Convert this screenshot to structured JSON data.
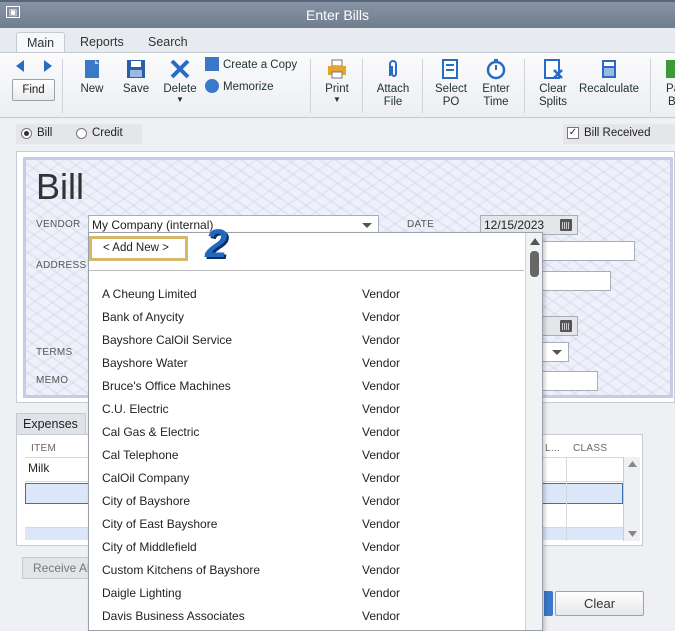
{
  "window": {
    "title": "Enter Bills"
  },
  "tabs": [
    {
      "label": "Main",
      "active": true
    },
    {
      "label": "Reports",
      "active": false
    },
    {
      "label": "Search",
      "active": false
    }
  ],
  "ribbon": {
    "find": "Find",
    "new": "New",
    "save": "Save",
    "delete": "Delete",
    "create_copy": "Create a Copy",
    "memorize": "Memorize",
    "print": "Print",
    "attach_file_1": "Attach",
    "attach_file_2": "File",
    "select_po_1": "Select",
    "select_po_2": "PO",
    "enter_time_1": "Enter",
    "enter_time_2": "Time",
    "clear_splits_1": "Clear",
    "clear_splits_2": "Splits",
    "recalculate": "Recalculate",
    "pay_bill_1": "Pa",
    "pay_bill_2": "B"
  },
  "options": {
    "bill": "Bill",
    "credit": "Credit",
    "bill_received": "Bill Received",
    "bill_selected": true,
    "bill_received_checked": true
  },
  "form": {
    "title": "Bill",
    "vendor_label": "VENDOR",
    "vendor_value": "My Company (internal)",
    "date_label": "DATE",
    "date_value": "12/15/2023",
    "address_label": "ADDRESS",
    "terms_label": "TERMS",
    "memo_label": "MEMO"
  },
  "expenses": {
    "tab_label": "Expenses",
    "col_item": "ITEM",
    "col_l": "L...",
    "col_class": "CLASS",
    "row1_item": "Milk"
  },
  "buttons": {
    "receive_all": "Receive All",
    "clear": "Clear"
  },
  "dropdown": {
    "add_new": "< Add New >",
    "items": [
      {
        "name": "A Cheung Limited",
        "type": "Vendor"
      },
      {
        "name": "Bank of Anycity",
        "type": "Vendor"
      },
      {
        "name": "Bayshore CalOil Service",
        "type": "Vendor"
      },
      {
        "name": "Bayshore Water",
        "type": "Vendor"
      },
      {
        "name": "Bruce's Office Machines",
        "type": "Vendor"
      },
      {
        "name": "C.U. Electric",
        "type": "Vendor"
      },
      {
        "name": "Cal Gas & Electric",
        "type": "Vendor"
      },
      {
        "name": "Cal Telephone",
        "type": "Vendor"
      },
      {
        "name": "CalOil Company",
        "type": "Vendor"
      },
      {
        "name": "City of Bayshore",
        "type": "Vendor"
      },
      {
        "name": "City of East Bayshore",
        "type": "Vendor"
      },
      {
        "name": "City of Middlefield",
        "type": "Vendor"
      },
      {
        "name": "Custom Kitchens of Bayshore",
        "type": "Vendor"
      },
      {
        "name": "Daigle Lighting",
        "type": "Vendor"
      },
      {
        "name": "Davis Business Associates",
        "type": "Vendor"
      }
    ]
  },
  "annotation": {
    "step": "2",
    "color": "#1f69c4",
    "highlight_color": "#d4b96b"
  }
}
